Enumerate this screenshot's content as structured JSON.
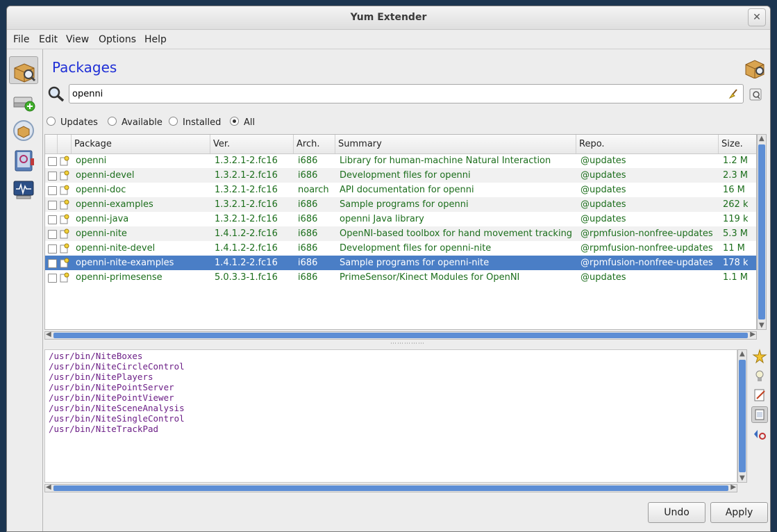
{
  "window": {
    "title": "Yum Extender"
  },
  "menu": [
    "File",
    "Edit",
    "View",
    "Options",
    "Help"
  ],
  "sidebar": {
    "items": [
      {
        "name": "packages-view",
        "active": true
      },
      {
        "name": "repositories-view",
        "active": false
      },
      {
        "name": "groups-view",
        "active": false
      },
      {
        "name": "history-view",
        "active": false
      },
      {
        "name": "output-view",
        "active": false
      }
    ]
  },
  "page": {
    "heading": "Packages"
  },
  "search": {
    "value": "openni",
    "placeholder": ""
  },
  "filters": {
    "options": [
      "Updates",
      "Available",
      "Installed",
      "All"
    ],
    "selected": "All"
  },
  "table": {
    "columns": [
      "Package",
      "Ver.",
      "Arch.",
      "Summary",
      "Repo.",
      "Size."
    ],
    "rows": [
      {
        "package": "openni",
        "version": "1.3.2.1-2.fc16",
        "arch": "i686",
        "summary": "Library for human-machine Natural Interaction",
        "repo": "@updates",
        "size": "1.2 M",
        "selected": false
      },
      {
        "package": "openni-devel",
        "version": "1.3.2.1-2.fc16",
        "arch": "i686",
        "summary": "Development files for openni",
        "repo": "@updates",
        "size": "2.3 M",
        "selected": false
      },
      {
        "package": "openni-doc",
        "version": "1.3.2.1-2.fc16",
        "arch": "noarch",
        "summary": "API documentation for openni",
        "repo": "@updates",
        "size": "16 M",
        "selected": false
      },
      {
        "package": "openni-examples",
        "version": "1.3.2.1-2.fc16",
        "arch": "i686",
        "summary": "Sample programs for openni",
        "repo": "@updates",
        "size": "262 k",
        "selected": false
      },
      {
        "package": "openni-java",
        "version": "1.3.2.1-2.fc16",
        "arch": "i686",
        "summary": "openni Java library",
        "repo": "@updates",
        "size": "119 k",
        "selected": false
      },
      {
        "package": "openni-nite",
        "version": "1.4.1.2-2.fc16",
        "arch": "i686",
        "summary": "OpenNI-based toolbox for hand movement tracking",
        "repo": "@rpmfusion-nonfree-updates",
        "size": "5.3 M",
        "selected": false
      },
      {
        "package": "openni-nite-devel",
        "version": "1.4.1.2-2.fc16",
        "arch": "i686",
        "summary": "Development files for openni-nite",
        "repo": "@rpmfusion-nonfree-updates",
        "size": "11 M",
        "selected": false
      },
      {
        "package": "openni-nite-examples",
        "version": "1.4.1.2-2.fc16",
        "arch": "i686",
        "summary": "Sample programs for openni-nite",
        "repo": "@rpmfusion-nonfree-updates",
        "size": "178 k",
        "selected": true
      },
      {
        "package": "openni-primesense",
        "version": "5.0.3.3-1.fc16",
        "arch": "i686",
        "summary": "PrimeSensor/Kinect Modules for OpenNI",
        "repo": "@updates",
        "size": "1.1 M",
        "selected": false
      }
    ]
  },
  "files": [
    "/usr/bin/NiteBoxes",
    "/usr/bin/NiteCircleControl",
    "/usr/bin/NitePlayers",
    "/usr/bin/NitePointServer",
    "/usr/bin/NitePointViewer",
    "/usr/bin/NiteSceneAnalysis",
    "/usr/bin/NiteSingleControl",
    "/usr/bin/NiteTrackPad"
  ],
  "info_tools": [
    "star-icon",
    "lightbulb-icon",
    "edit-icon",
    "file-list-icon",
    "changelog-icon"
  ],
  "buttons": {
    "undo": "Undo",
    "apply": "Apply"
  }
}
